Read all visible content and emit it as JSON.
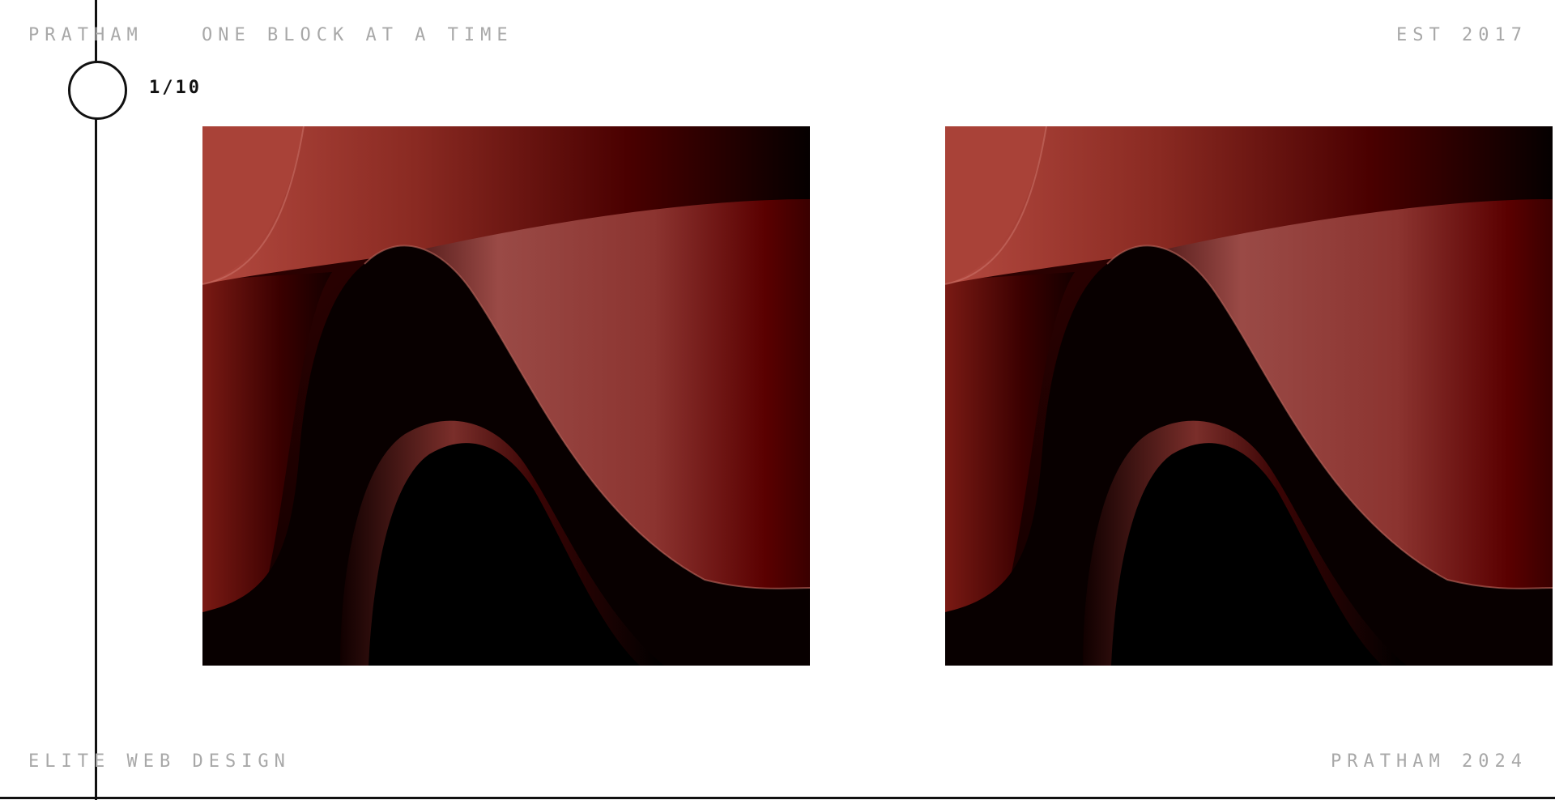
{
  "header": {
    "brand": "PRATHAM",
    "tagline": "ONE BLOCK AT A TIME",
    "established": "EST 2017"
  },
  "slider": {
    "counter": "1/10",
    "slides": [
      {
        "image": "abstract-red-waves"
      },
      {
        "image": "abstract-red-waves"
      }
    ]
  },
  "footer": {
    "left": "ELITE WEB DESIGN",
    "right": "PRATHAM 2024"
  },
  "colors": {
    "background": "#ffffff",
    "line": "#111111",
    "muted_text": "#a8a8a8",
    "wave_red": "#8e2a22",
    "wave_dark": "#4a0000"
  }
}
